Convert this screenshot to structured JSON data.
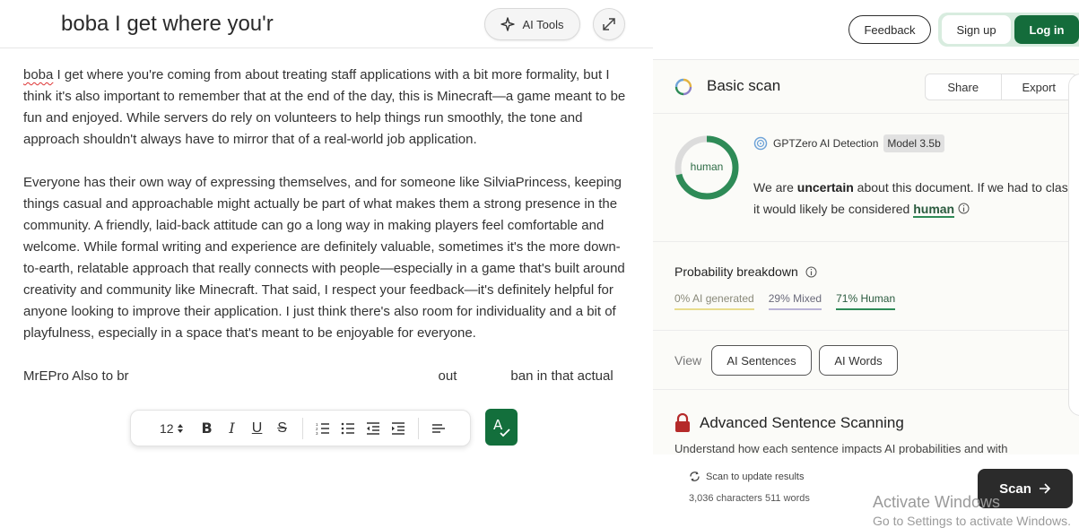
{
  "editor": {
    "title": "boba I get where you'r",
    "ai_tools_label": "AI Tools",
    "paragraphs": {
      "p1_first": "boba",
      "p1_rest": " I get where you're coming from about treating staff applications with a bit more formality, but I think it's also important to remember that at the end of the day, this is Minecraft—a game meant to be fun and enjoyed. While servers do rely on volunteers to help things run smoothly, the tone and approach shouldn't always have to mirror that of a real-world job application.",
      "p2": "Everyone has their own way of expressing themselves, and for someone like SilviaPrincess, keeping things casual and approachable might actually be part of what makes them a strong presence in the community. A friendly, laid-back attitude can go a long way in making players feel comfortable and welcome. While formal writing and experience are definitely valuable, sometimes it's the more down-to-earth, relatable approach that really connects with people—especially in a game that's built around creativity and community like Minecraft. That said, I respect your feedback—it's definitely helpful for anyone looking to improve their application. I just think there's also room for individuality and a bit of playfulness, especially in a space that's meant to be enjoyable for everyone.",
      "p3_start": "MrEPro Also to br",
      "p3_end": "out",
      "p3_tail": "ban in that actual"
    },
    "toolbar": {
      "font_size": "12"
    }
  },
  "header": {
    "feedback_label": "Feedback",
    "signup_label": "Sign up",
    "login_label": "Log in"
  },
  "scan": {
    "title": "Basic scan",
    "share_label": "Share",
    "export_label": "Export",
    "result_label": "human",
    "detector_name": "GPTZero AI Detection",
    "model_badge": "Model 3.5b",
    "verdict_pre": "We are ",
    "verdict_strong": "uncertain",
    "verdict_mid": " about this document. If we had to classify it, it would likely be considered ",
    "verdict_word": "human",
    "human_fraction": 0.71,
    "probability": {
      "title": "Probability breakdown",
      "ai": "0% AI generated",
      "mixed": "29% Mixed",
      "human": "71% Human",
      "colors": {
        "ai": "#e8dc8c",
        "mixed": "#b9b3d6",
        "human": "#2e8b57"
      }
    },
    "view": {
      "label": "View",
      "ai_sentences": "AI Sentences",
      "ai_words": "AI Words"
    },
    "advanced": {
      "title": "Advanced Sentence Scanning",
      "desc": "Understand how each sentence impacts AI probabilities and with"
    }
  },
  "footer": {
    "update_text": "Scan to update results",
    "counts": "3,036 characters 511 words",
    "scan_label": "Scan",
    "watermark_title": "Activate Windows",
    "watermark_sub": "Go to Settings to activate Windows."
  },
  "colors": {
    "brand_green": "#146c3b",
    "dark_button": "#2b2b2b"
  }
}
